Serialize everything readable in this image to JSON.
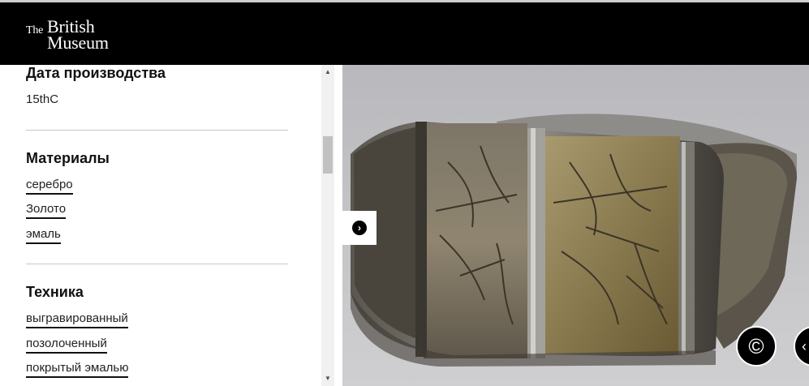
{
  "header": {
    "logo_the": "The",
    "logo_british": "British",
    "logo_museum": "Museum"
  },
  "details": {
    "production_date": {
      "title": "Дата производства",
      "value": "15thC"
    },
    "materials": {
      "title": "Материалы",
      "items": [
        "серебро",
        "Золото",
        "эмаль"
      ]
    },
    "technique": {
      "title": "Техника",
      "items": [
        "выгравированный",
        "позолоченный",
        "покрытый эмалью"
      ]
    }
  },
  "viewer": {
    "image_subject": "engraved silver-gilt ring",
    "copyright_glyph": "©",
    "expand_glyph": "›",
    "next_glyph": "‹"
  },
  "scrollbar": {
    "up_glyph": "▲",
    "down_glyph": "▼"
  }
}
